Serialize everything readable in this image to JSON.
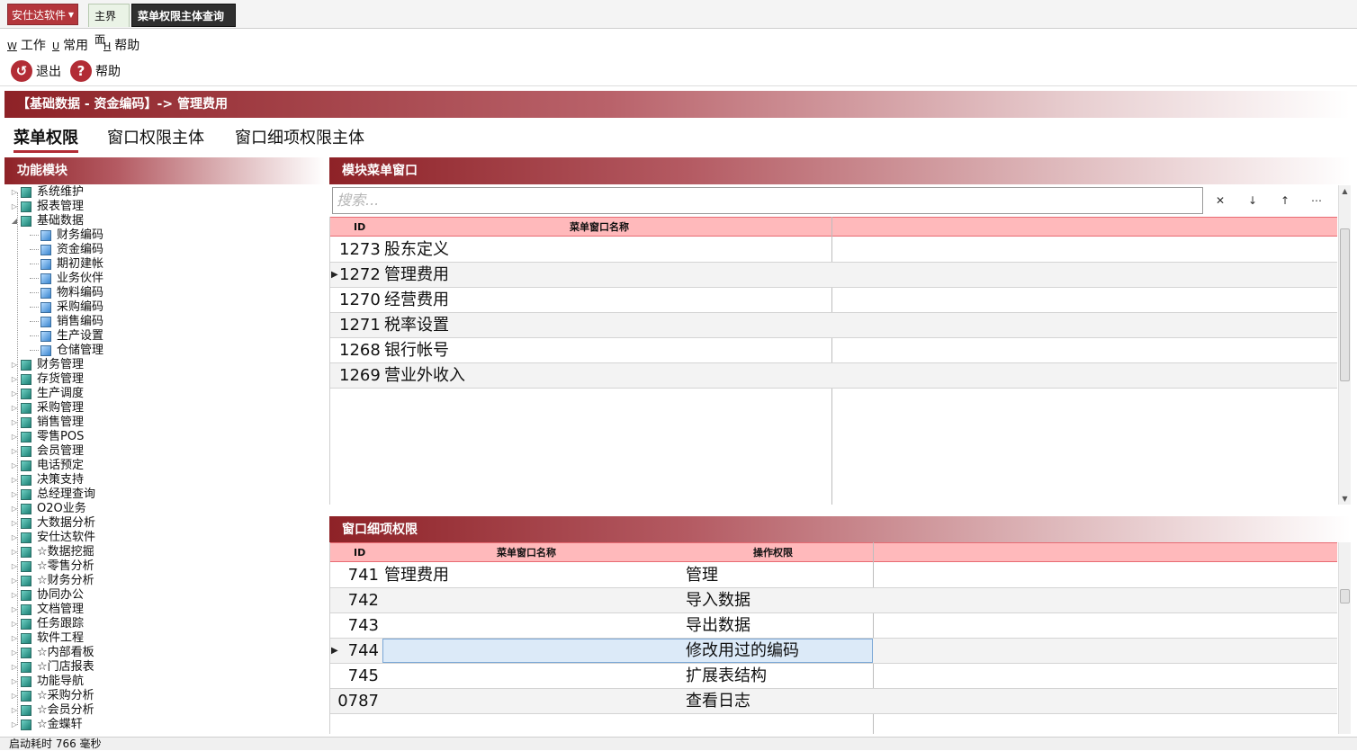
{
  "app": {
    "name": "安仕达软件"
  },
  "tabs": [
    {
      "label": "主界面"
    },
    {
      "label": "菜单权限主体查询"
    }
  ],
  "menubar": [
    {
      "key": "W",
      "label": "工作"
    },
    {
      "key": "U",
      "label": "常用"
    },
    {
      "key": "H",
      "label": "帮助"
    }
  ],
  "toolbar": {
    "exit": "退出",
    "help": "帮助"
  },
  "breadcrumb": "【基础数据 - 资金编码】-> 管理费用",
  "section_tabs": [
    "菜单权限",
    "窗口权限主体",
    "窗口细项权限主体"
  ],
  "left_panel": {
    "title": "功能模块",
    "tree": [
      {
        "label": "系统维护"
      },
      {
        "label": "报表管理"
      },
      {
        "label": "基础数据",
        "expanded": true
      },
      {
        "label": "财务编码",
        "child": true
      },
      {
        "label": "资金编码",
        "child": true
      },
      {
        "label": "期初建帐",
        "child": true
      },
      {
        "label": "业务伙伴",
        "child": true
      },
      {
        "label": "物料编码",
        "child": true
      },
      {
        "label": "采购编码",
        "child": true
      },
      {
        "label": "销售编码",
        "child": true
      },
      {
        "label": "生产设置",
        "child": true
      },
      {
        "label": "仓储管理",
        "child": true
      },
      {
        "label": "财务管理"
      },
      {
        "label": "存货管理"
      },
      {
        "label": "生产调度"
      },
      {
        "label": "采购管理"
      },
      {
        "label": "销售管理"
      },
      {
        "label": "零售POS"
      },
      {
        "label": "会员管理"
      },
      {
        "label": "电话预定"
      },
      {
        "label": "决策支持"
      },
      {
        "label": "总经理查询"
      },
      {
        "label": "O2O业务"
      },
      {
        "label": "大数据分析"
      },
      {
        "label": "安仕达软件"
      },
      {
        "label": "☆数据挖掘"
      },
      {
        "label": "☆零售分析"
      },
      {
        "label": "☆财务分析"
      },
      {
        "label": "协同办公"
      },
      {
        "label": "文档管理"
      },
      {
        "label": "任务跟踪"
      },
      {
        "label": "软件工程"
      },
      {
        "label": "☆内部看板"
      },
      {
        "label": "☆门店报表"
      },
      {
        "label": "功能导航"
      },
      {
        "label": "☆采购分析"
      },
      {
        "label": "☆会员分析"
      },
      {
        "label": "☆金蝶轩"
      }
    ]
  },
  "module_panel": {
    "title": "模块菜单窗口",
    "search_placeholder": "搜索...",
    "search_buttons": [
      "✕",
      "↓",
      "↑",
      "⋯"
    ],
    "columns": [
      "ID",
      "菜单窗口名称"
    ],
    "rows": [
      {
        "id": "1273",
        "name": "股东定义"
      },
      {
        "id": "1272",
        "name": "管理费用",
        "current": true
      },
      {
        "id": "1270",
        "name": "经营费用"
      },
      {
        "id": "1271",
        "name": "税率设置"
      },
      {
        "id": "1268",
        "name": "银行帐号"
      },
      {
        "id": "1269",
        "name": "营业外收入"
      }
    ]
  },
  "detail_panel": {
    "title": "窗口细项权限",
    "columns": [
      "ID",
      "菜单窗口名称",
      "操作权限"
    ],
    "rows": [
      {
        "id": "741",
        "name": "管理费用",
        "perm": "管理"
      },
      {
        "id": "742",
        "name": "",
        "perm": "导入数据"
      },
      {
        "id": "743",
        "name": "",
        "perm": "导出数据"
      },
      {
        "id": "744",
        "name": "",
        "perm": "修改用过的编码",
        "current": true
      },
      {
        "id": "745",
        "name": "",
        "perm": "扩展表结构"
      },
      {
        "id": "0787",
        "name": "",
        "perm": "查看日志"
      }
    ]
  },
  "status": "启动耗时 766 毫秒"
}
